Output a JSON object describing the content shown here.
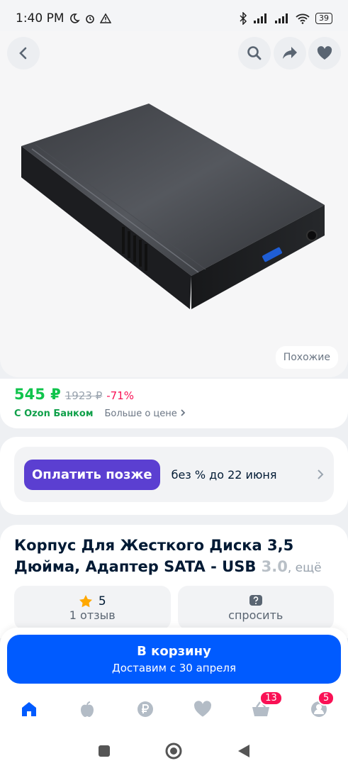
{
  "status_bar": {
    "time": "1:40 PM",
    "battery": "39"
  },
  "product_image": {
    "similar_label": "Похожие"
  },
  "price": {
    "current": "545 ₽",
    "old": "1923 ₽",
    "discount": "-71%",
    "bank_label": "С Ozon Банком",
    "more_label": "Больше о цене"
  },
  "pay_later": {
    "button_label": "Оплатить позже",
    "text": "без % до 22 июня"
  },
  "product": {
    "title_main": "Корпус Для Жесткого Диска 3,5 Дюйма, Адаптер SATA - USB ",
    "title_fade": "3.0",
    "more_label": ", ещё"
  },
  "tiles": {
    "rating_value": "5",
    "rating_caption": "1 отзыв",
    "ask_caption": "спросить"
  },
  "cart": {
    "label": "В корзину",
    "delivery": "Доставим с 30 апреля"
  },
  "nav": {
    "cart_badge": "13",
    "profile_badge": "5"
  },
  "colors": {
    "brand": "#005bff",
    "price_green": "#10c44c",
    "discount_red": "#f91155",
    "paylater_purple": "#5b3fd1"
  }
}
